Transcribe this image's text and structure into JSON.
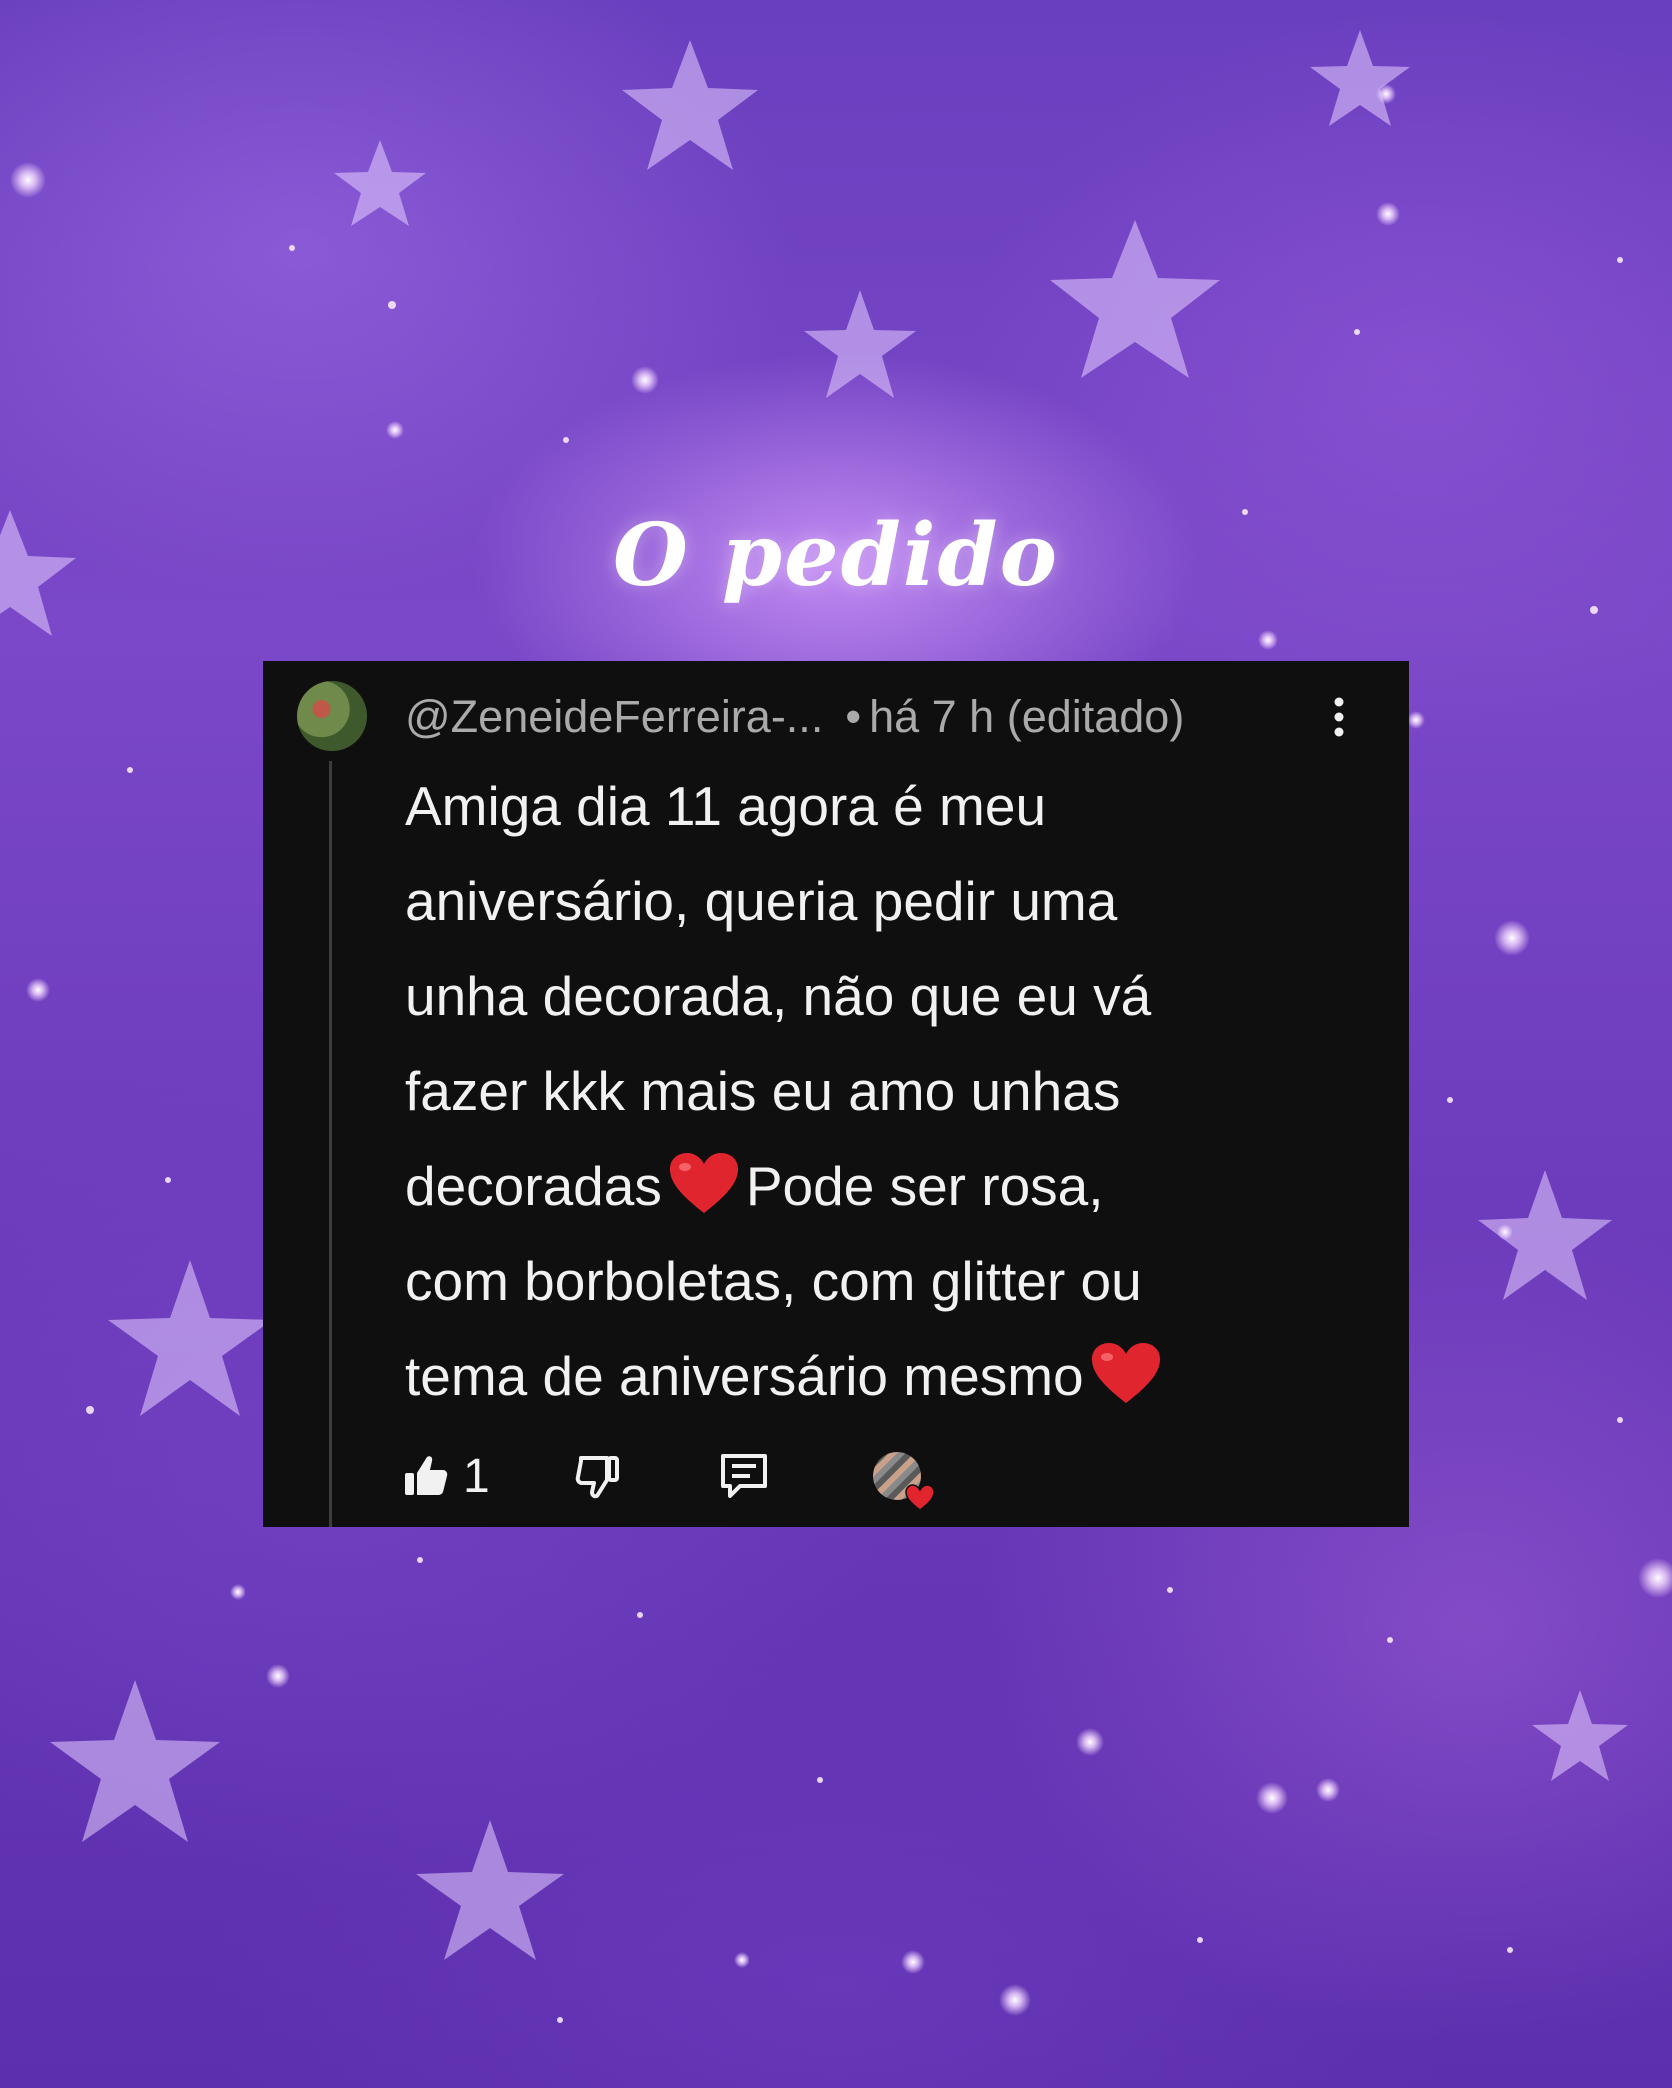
{
  "title": "O pedido",
  "comment": {
    "username": "@ZeneideFerreira-...",
    "separator": "•",
    "timestamp": "há 7 h (editado)",
    "lines": {
      "l1": "Amiga dia 11 agora é meu",
      "l2": "aniversário, queria pedir uma",
      "l3": "unha decorada, não que eu vá",
      "l4": "fazer kkk mais eu amo unhas",
      "l5a": "decoradas",
      "l5b": "Pode ser rosa,",
      "l6": "com borboletas, com glitter ou",
      "l7": "tema de aniversário mesmo"
    },
    "like_count": "1"
  },
  "colors": {
    "card_background": "#0f0f0f",
    "text_primary": "#f1f1f1",
    "text_secondary": "#aaaaaa",
    "heart": "#e0252e"
  },
  "icons": [
    "avatar",
    "more-vert-icon",
    "heart-emoji-icon",
    "thumbs-up-icon",
    "thumbs-down-icon",
    "reply-icon",
    "creator-heart-icon"
  ]
}
